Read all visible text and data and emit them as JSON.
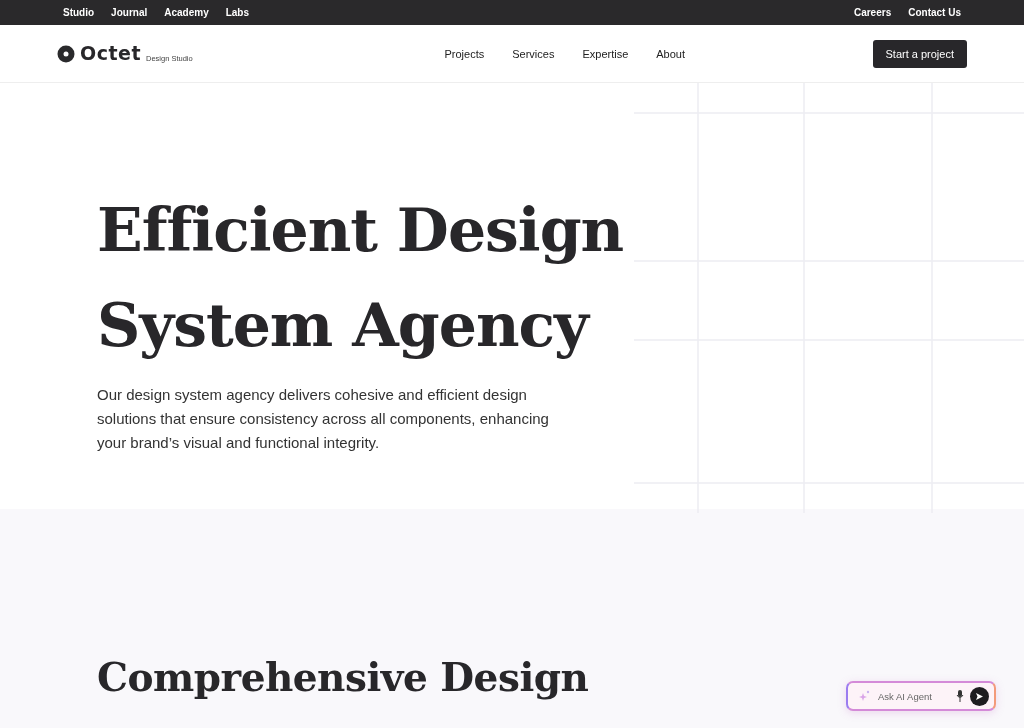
{
  "top_bar": {
    "left_links": [
      "Studio",
      "Journal",
      "Academy",
      "Labs"
    ],
    "right_links": [
      "Careers",
      "Contact Us"
    ]
  },
  "header": {
    "logo": "Octet",
    "logo_tagline": "Design Studio",
    "nav": [
      "Projects",
      "Services",
      "Expertise",
      "About"
    ],
    "cta": "Start a project"
  },
  "hero": {
    "title_lines": [
      "Efficient Design",
      "System Agency"
    ],
    "description": "Our design system agency delivers cohesive and efficient design solutions that ensure consistency across all components, enhancing your brand’s visual and functional integrity."
  },
  "section": {
    "heading": "Comprehensive Design"
  },
  "ai_agent": {
    "placeholder": "Ask AI Agent"
  }
}
